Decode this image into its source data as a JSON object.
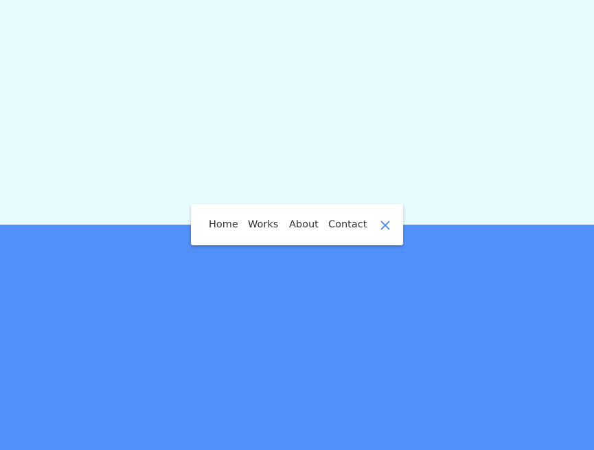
{
  "nav": {
    "items": [
      {
        "label": "Home"
      },
      {
        "label": "Works"
      },
      {
        "label": "About"
      },
      {
        "label": "Contact"
      }
    ],
    "close_icon": "close-icon"
  },
  "colors": {
    "top_bg": "#e8fbff",
    "bottom_bg": "#5190f8",
    "accent": "#4a86e8"
  }
}
